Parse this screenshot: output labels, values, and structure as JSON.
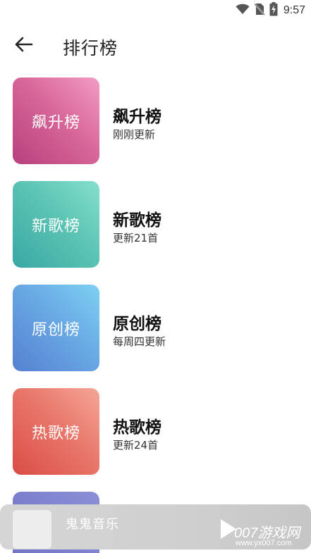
{
  "status_bar": {
    "time": "9:57",
    "icons": [
      "wifi-icon",
      "no-sim-icon",
      "battery-charging-icon"
    ]
  },
  "header": {
    "back_icon": "arrow-left-icon",
    "title": "排行榜"
  },
  "charts": [
    {
      "cover_text": "飙升榜",
      "name": "飙升榜",
      "desc": "刚刚更新",
      "color": "#d8679a"
    },
    {
      "cover_text": "新歌榜",
      "name": "新歌榜",
      "desc": "更新21首",
      "color": "#5cc4b4"
    },
    {
      "cover_text": "原创榜",
      "name": "原创榜",
      "desc": "每周四更新",
      "color": "#69a9e4"
    },
    {
      "cover_text": "热歌榜",
      "name": "热歌榜",
      "desc": "更新24首",
      "color": "#e9776b"
    },
    {
      "color": "#6e70c4"
    }
  ],
  "mini_player": {
    "title": "鬼鬼音乐",
    "play_icon": "play-icon"
  },
  "watermark": {
    "brand": "007游戏网",
    "url": "www.yx007.com"
  }
}
